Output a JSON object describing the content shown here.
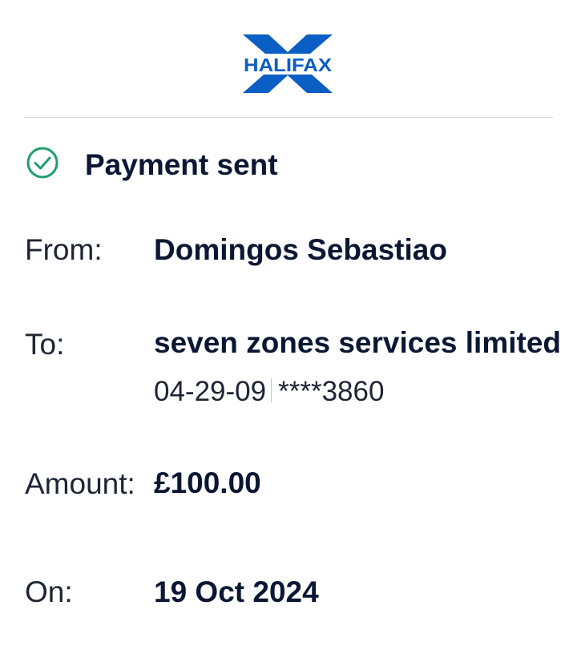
{
  "brand": {
    "logo_text": "HALIFAX",
    "logo_color": "#0a5ec4"
  },
  "status": {
    "icon": "check-circle-icon",
    "icon_color": "#1f9e6c",
    "title": "Payment sent"
  },
  "details": {
    "from_label": "From:",
    "from_value": "Domingos Sebastiao",
    "to_label": "To:",
    "to_value": "seven zones services limited",
    "to_sort_code": "04-29-09",
    "to_account": "****3860",
    "amount_label": "Amount:",
    "amount_value": "£100.00",
    "on_label": "On:",
    "on_value": "19 Oct 2024"
  }
}
